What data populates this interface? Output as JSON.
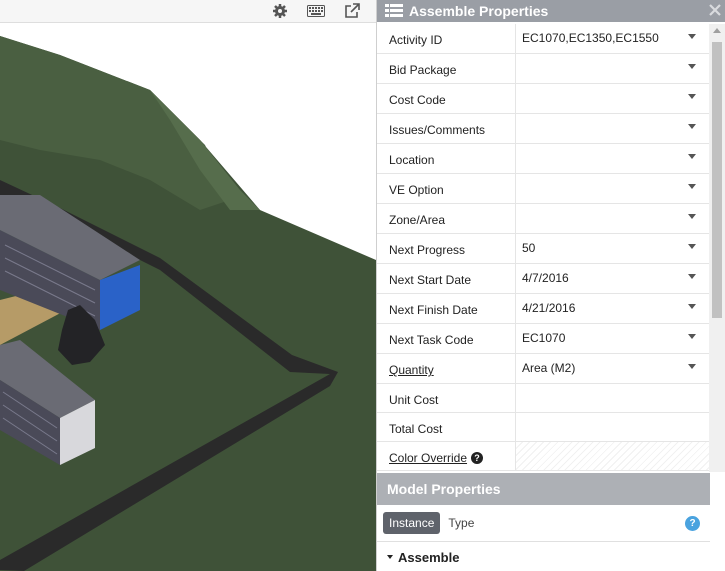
{
  "viewport": {
    "toolbar_icons": [
      "gear-icon",
      "keyboard-icon",
      "external-link-icon"
    ]
  },
  "panel": {
    "title": "Assemble Properties",
    "title_icon": "list-icon",
    "properties": [
      {
        "label": "Activity ID",
        "value": "EC1070,EC1350,EC1550"
      },
      {
        "label": "Bid Package",
        "value": ""
      },
      {
        "label": "Cost Code",
        "value": ""
      },
      {
        "label": "Issues/Comments",
        "value": ""
      },
      {
        "label": "Location",
        "value": ""
      },
      {
        "label": "VE Option",
        "value": ""
      },
      {
        "label": "Zone/Area",
        "value": ""
      },
      {
        "label": "Next Progress",
        "value": "50"
      },
      {
        "label": "Next Start Date",
        "value": "4/7/2016"
      },
      {
        "label": "Next Finish Date",
        "value": "4/21/2016"
      },
      {
        "label": "Next Task Code",
        "value": "EC1070"
      },
      {
        "label": "Quantity",
        "value": "Area (M2)"
      },
      {
        "label": "Unit Cost",
        "value": ""
      },
      {
        "label": "Total Cost",
        "value": ""
      },
      {
        "label": "Color Override",
        "value": ""
      }
    ],
    "help_glyph": "?"
  },
  "model_properties": {
    "title": "Model Properties",
    "tab_instance": "Instance",
    "tab_type": "Type",
    "help_glyph": "?",
    "section": "Assemble"
  },
  "colors": {
    "terrain": "#3f5238",
    "terrain_light": "#4d6344",
    "road": "#2a2a2a",
    "roof": "#6a6b74",
    "header": "#9a9ea5",
    "accent_blue": "#1f6fd0"
  }
}
